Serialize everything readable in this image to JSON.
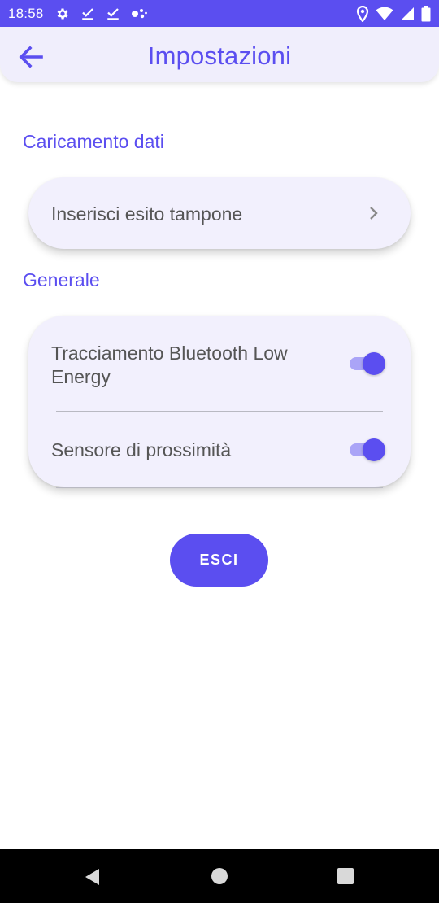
{
  "status_bar": {
    "time": "18:58",
    "left_icons": [
      "gear-icon",
      "download-done-icon",
      "download-done-icon",
      "dots-icon"
    ],
    "right_icons": [
      "location-icon",
      "wifi-icon",
      "signal-icon",
      "battery-icon"
    ],
    "background": "#5b4ef0"
  },
  "app_bar": {
    "title": "Impostazioni",
    "back_icon": "arrow-left-icon",
    "accent": "#5b4ef0"
  },
  "sections": [
    {
      "label": "Caricamento dati",
      "items": [
        {
          "label": "Inserisci esito tampone",
          "icon": "chevron-right-icon"
        }
      ]
    },
    {
      "label": "Generale",
      "items": [
        {
          "label": "Tracciamento Bluetooth Low Energy",
          "toggle": true
        },
        {
          "label": "Sensore di prossimità",
          "toggle": true
        }
      ]
    }
  ],
  "exit_button": {
    "label": "ESCI"
  },
  "nav_bar": {
    "icons": [
      "back-triangle-icon",
      "home-circle-icon",
      "recents-square-icon"
    ]
  }
}
